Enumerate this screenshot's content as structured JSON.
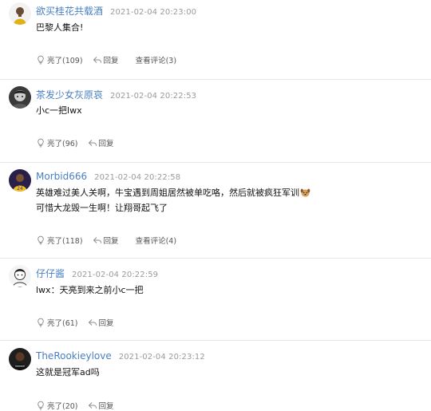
{
  "comments": [
    {
      "username": "欲买桂花共载酒",
      "time": "2021-02-04 20:23:00",
      "lines": [
        "巴黎人集合!"
      ],
      "like_label": "亮了(109)",
      "reply_label": "回复",
      "view_label": "查看评论(3)"
    },
    {
      "username": "茶发少女灰原哀",
      "time": "2021-02-04 20:22:53",
      "lines": [
        "小c一把lwx"
      ],
      "like_label": "亮了(96)",
      "reply_label": "回复"
    },
    {
      "username": "Morbid666",
      "time": "2021-02-04 20:22:58",
      "lines": [
        "英雄难过美人关啊，牛宝遇到周姐居然被单吃咯，然后就被疯狂军训",
        "可惜大龙毁一生啊！让翔哥起飞了"
      ],
      "like_label": "亮了(118)",
      "reply_label": "回复",
      "view_label": "查看评论(4)"
    },
    {
      "username": "仔仔酱",
      "time": "2021-02-04 20:22:59",
      "lines": [
        "lwx：天亮到来之前小c一把"
      ],
      "like_label": "亮了(61)",
      "reply_label": "回复"
    },
    {
      "username": "TheRookieylove",
      "time": "2021-02-04 20:23:12",
      "lines": [
        "这就是冠军ad吗"
      ],
      "like_label": "亮了(20)",
      "reply_label": "回复"
    }
  ],
  "colors": {
    "username": "#4a7fc1",
    "timestamp": "#9a9a9a",
    "action_text": "#555555",
    "divider": "#e6e6e6"
  },
  "icons": {
    "like": "lightbulb-icon",
    "reply": "reply-arrow-icon",
    "emoji": "dog-emoji-icon"
  }
}
